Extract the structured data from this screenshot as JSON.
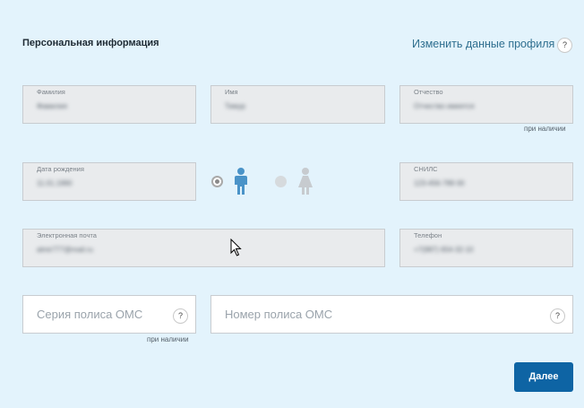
{
  "header": {
    "title": "Персональная информация",
    "edit_profile_link": "Изменить данные профиля",
    "help_glyph": "?"
  },
  "fields": {
    "surname": {
      "label": "Фамилия",
      "value": "Фамилия"
    },
    "name": {
      "label": "Имя",
      "value": "Тимур"
    },
    "patronymic": {
      "label": "Отчество",
      "value": "Отчество имеется"
    },
    "patronymic_note": "при наличии",
    "birthdate": {
      "label": "Дата рождения",
      "value": "11.01.1990"
    },
    "snils": {
      "label": "СНИЛС",
      "value": "123-456-789 00"
    },
    "email": {
      "label": "Электронная почта",
      "value": "almir777@mail.ru"
    },
    "phone": {
      "label": "Телефон",
      "value": "+7(987) 654-32-10"
    }
  },
  "gender": {
    "selected": "male",
    "male_icon": "male-person-icon",
    "female_icon": "female-person-icon",
    "colors": {
      "male": "#4a93c8",
      "female": "#c7cbcf"
    }
  },
  "oms": {
    "series_placeholder": "Серия полиса ОМС",
    "series_note": "при наличии",
    "number_placeholder": "Номер полиса ОМС"
  },
  "actions": {
    "next_label": "Далее"
  },
  "colors": {
    "background": "#e3f3fc",
    "primary_button": "#0e64a4",
    "link": "#2f6f8f"
  }
}
